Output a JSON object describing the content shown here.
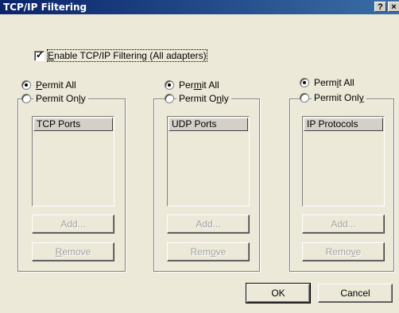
{
  "window": {
    "title": "TCP/IP Filtering",
    "help_button": "?",
    "close_button": "×"
  },
  "enable": {
    "label_u": "E",
    "label_rest": "nable TCP/IP Filtering (All adapters)",
    "checked": true
  },
  "groups": [
    {
      "permit_all_pre": "",
      "permit_all_u": "P",
      "permit_all_post": "ermit All",
      "permit_only_pre": "Permit On",
      "permit_only_u": "l",
      "permit_only_post": "y",
      "selected": "permit_all",
      "list_header": "TCP Ports",
      "add_label": "Add...",
      "remove_pre": "",
      "remove_u": "R",
      "remove_post": "emove"
    },
    {
      "permit_all_pre": "Per",
      "permit_all_u": "m",
      "permit_all_post": "it All",
      "permit_only_pre": "Permit O",
      "permit_only_u": "n",
      "permit_only_post": "ly",
      "selected": "permit_all",
      "list_header": "UDP Ports",
      "add_label": "Add...",
      "remove_pre": "Rem",
      "remove_u": "o",
      "remove_post": "ve"
    },
    {
      "permit_all_pre": "Perm",
      "permit_all_u": "i",
      "permit_all_post": "t All",
      "permit_only_pre": "Permit Onl",
      "permit_only_u": "y",
      "permit_only_post": "",
      "selected": "permit_all",
      "list_header": "IP Protocols",
      "add_label": "Add...",
      "remove_pre": "Remo",
      "remove_u": "v",
      "remove_post": "e"
    }
  ],
  "footer": {
    "ok_label": "OK",
    "cancel_label": "Cancel"
  }
}
